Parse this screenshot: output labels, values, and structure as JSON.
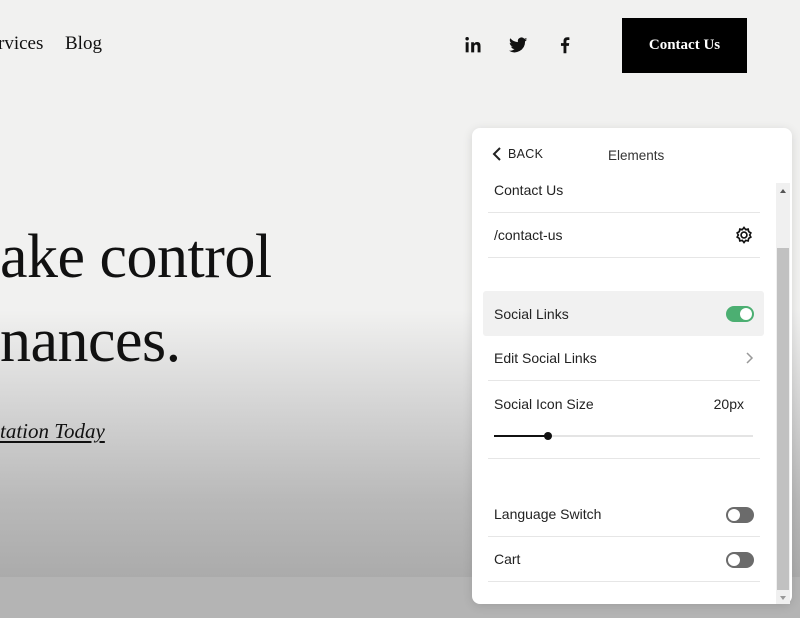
{
  "nav": {
    "items": [
      {
        "label": "rvices"
      },
      {
        "label": "Blog"
      }
    ]
  },
  "social_icons": [
    "linkedin-icon",
    "twitter-icon",
    "facebook-icon"
  ],
  "header": {
    "contact_button": "Contact Us"
  },
  "hero": {
    "line1": "ake control",
    "line2": "nances.",
    "link": "tation Today"
  },
  "panel": {
    "back_label": "BACK",
    "title": "Elements",
    "button_text": "Contact Us",
    "button_link": "/contact-us",
    "social_links": {
      "label": "Social Links",
      "enabled": true
    },
    "edit_social_links": "Edit Social Links",
    "social_icon_size": {
      "label": "Social Icon Size",
      "value": "20px",
      "slider_fraction": 0.21
    },
    "language_switch": {
      "label": "Language Switch",
      "enabled": false
    },
    "cart": {
      "label": "Cart",
      "enabled": false
    }
  },
  "colors": {
    "toggle_on": "#4caf72",
    "toggle_off": "#6b6b6b",
    "button_bg": "#000000"
  }
}
